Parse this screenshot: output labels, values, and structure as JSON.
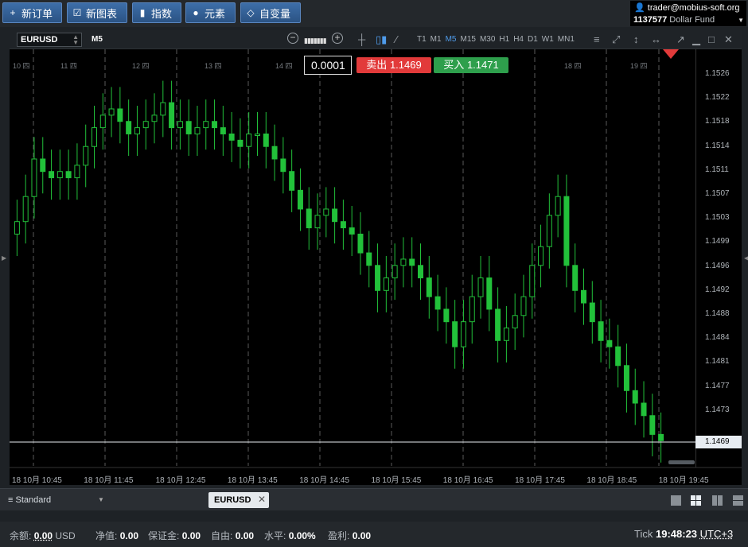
{
  "toolbar": {
    "new_order": "新订单",
    "new_chart": "新图表",
    "indicators": "指数",
    "elements": "元素",
    "custom": "自变量"
  },
  "account": {
    "email": "trader@mobius-soft.org",
    "number": "1137577",
    "fund": "Dollar Fund"
  },
  "chart": {
    "symbol": "EURUSD",
    "timeframe": "M5",
    "timeframes": [
      "T1",
      "M1",
      "M5",
      "M15",
      "M30",
      "H1",
      "H4",
      "D1",
      "W1",
      "MN1"
    ],
    "active_timeframe": "M5",
    "spread": "0.0001",
    "sell_label": "卖出",
    "sell_price": "1.1469",
    "buy_label": "买入",
    "buy_price": "1.1471",
    "current_price": "1.1469",
    "bull_color": "#22c13a",
    "bear_color": "#22c13a"
  },
  "chart_data": {
    "type": "candlestick",
    "y_ticks": [
      "1.1526",
      "1.1522",
      "1.1518",
      "1.1514",
      "1.1511",
      "1.1507",
      "1.1503",
      "1.1499",
      "1.1496",
      "1.1492",
      "1.1488",
      "1.1484",
      "1.1481",
      "1.1477",
      "1.1473"
    ],
    "ylim": [
      1.1467,
      1.153
    ],
    "date_labels": [
      "10 四",
      "11 四",
      "12 四",
      "13 四",
      "14 四",
      "18 四",
      "19 四"
    ],
    "x_ticks": [
      "18 10月 10:45",
      "18 10月 11:45",
      "18 10月 12:45",
      "18 10月 13:45",
      "18 10月 14:45",
      "18 10月 15:45",
      "18 10月 16:45",
      "18 10月 17:45",
      "18 10月 18:45",
      "18 10月 19:45"
    ],
    "close_series": [
      1.1504,
      1.1508,
      1.1514,
      1.1512,
      1.1511,
      1.1512,
      1.1511,
      1.1513,
      1.1516,
      1.1519,
      1.1521,
      1.1522,
      1.152,
      1.1518,
      1.1519,
      1.152,
      1.1521,
      1.1523,
      1.1519,
      1.152,
      1.1518,
      1.1519,
      1.152,
      1.1519,
      1.1518,
      1.1517,
      1.1516,
      1.1518,
      1.1518,
      1.1516,
      1.1514,
      1.1512,
      1.1509,
      1.1506,
      1.1503,
      1.1505,
      1.1506,
      1.1504,
      1.1503,
      1.1502,
      1.1499,
      1.1497,
      1.1493,
      1.1495,
      1.1497,
      1.1498,
      1.1497,
      1.1495,
      1.1492,
      1.149,
      1.1488,
      1.1484,
      1.1488,
      1.1492,
      1.1495,
      1.149,
      1.1485,
      1.1487,
      1.1489,
      1.1492,
      1.1497,
      1.15,
      1.1505,
      1.1508,
      1.1497,
      1.1493,
      1.1491,
      1.1488,
      1.1485,
      1.1484,
      1.1481,
      1.1477,
      1.1475,
      1.1473,
      1.147,
      1.1469
    ]
  },
  "tabs": {
    "layout_name": "Standard",
    "active_tab": "EURUSD"
  },
  "status": {
    "balance_label": "余额:",
    "balance_value": "0.00",
    "balance_ccy": "USD",
    "equity_label": "净值:",
    "equity_value": "0.00",
    "margin_label": "保证金:",
    "margin_value": "0.00",
    "free_label": "自由:",
    "free_value": "0.00",
    "level_label": "水平:",
    "level_value": "0.00%",
    "pl_label": "盈利:",
    "pl_value": "0.00",
    "tick_label": "Tick",
    "time": "19:48:23",
    "tz": "UTC+3"
  }
}
